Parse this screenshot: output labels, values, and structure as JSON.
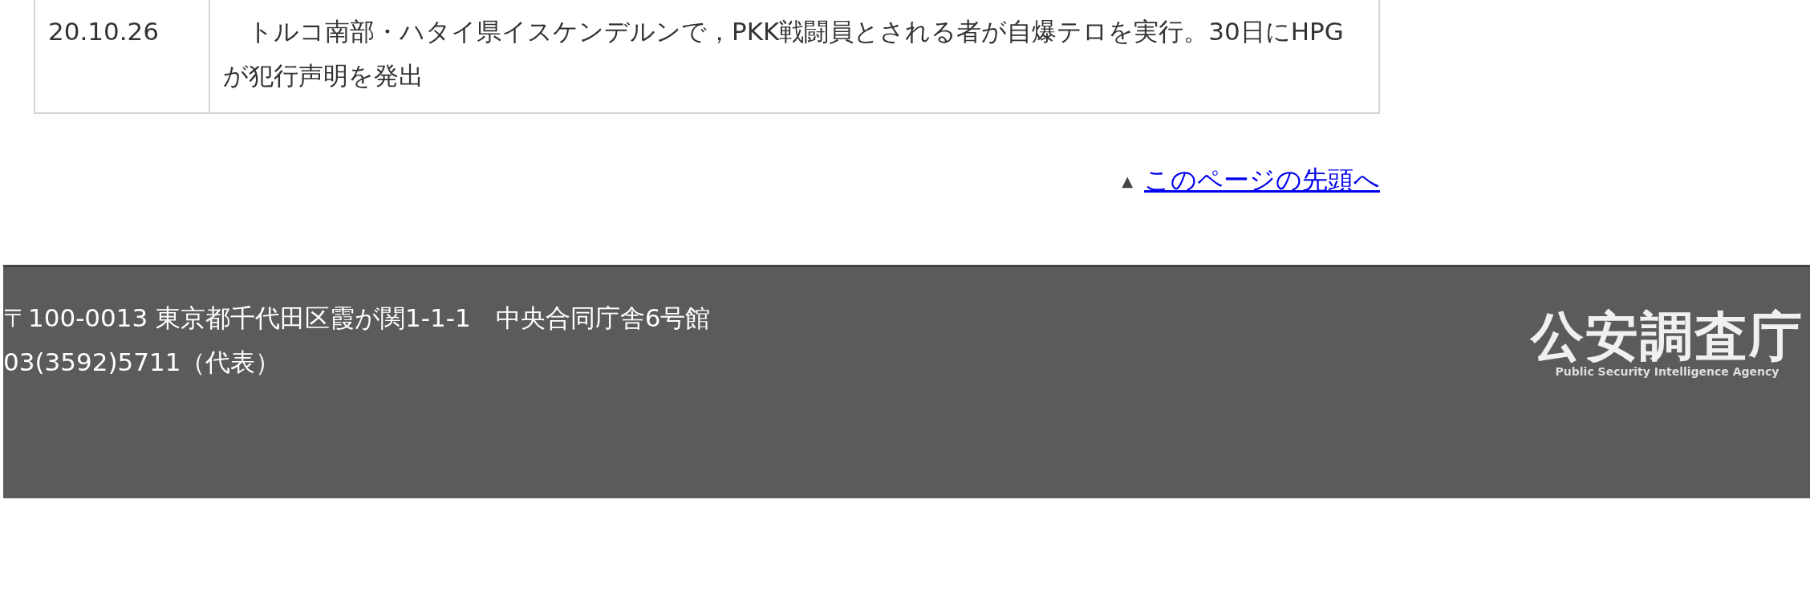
{
  "table": {
    "rows": [
      {
        "date": "20.10.26",
        "text": "　トルコ南部・ハタイ県イスケンデルンで，PKK戦闘員とされる者が自爆テロを実行。30日にHPGが犯行声明を発出"
      }
    ]
  },
  "page_top_link": {
    "marker": "▲",
    "label": "このページの先頭へ"
  },
  "footer": {
    "address_lines": [
      "〒100-0013 東京都千代田区霞が関1-1-1　中央合同庁舎6号館",
      "03(3592)5711（代表）"
    ],
    "logo": {
      "name": "公安調査庁",
      "subtitle": "Public Security Intelligence Agency"
    }
  }
}
